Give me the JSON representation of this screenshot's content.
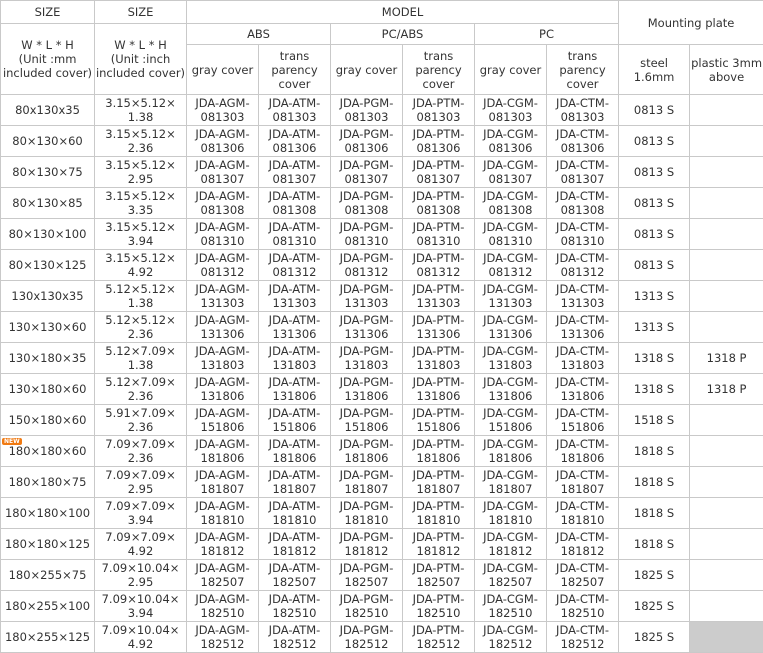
{
  "headers": {
    "size_mm_top": "SIZE",
    "size_inch_top": "SIZE",
    "model": "MODEL",
    "mounting_plate": "Mounting plate",
    "abs": "ABS",
    "pc_abs": "PC/ABS",
    "pc": "PC",
    "size_mm_sub": "W * L * H\n(Unit :mm\nincluded cover)",
    "size_inch_sub": "W * L * H\n(Unit :inch\nincluded cover)",
    "gray_cover": "gray cover",
    "trans_cover": "trans\nparency\ncover",
    "steel": "steel\n1.6mm",
    "plastic": "plastic 3mm\nabove"
  },
  "new_badge": "NEW",
  "rows": [
    {
      "mm": "80x130x35",
      "inch": "3.15×5.12×\n1.38",
      "abs_gray": "JDA-AGM-\n081303",
      "abs_trans": "JDA-ATM-\n081303",
      "pcabs_gray": "JDA-PGM-\n081303",
      "pcabs_trans": "JDA-PTM-\n081303",
      "pc_gray": "JDA-CGM-\n081303",
      "pc_trans": "JDA-CTM-\n081303",
      "steel": "0813 S",
      "plastic": ""
    },
    {
      "mm": "80×130×60",
      "inch": "3.15×5.12×\n2.36",
      "abs_gray": "JDA-AGM-\n081306",
      "abs_trans": "JDA-ATM-\n081306",
      "pcabs_gray": "JDA-PGM-\n081306",
      "pcabs_trans": "JDA-PTM-\n081306",
      "pc_gray": "JDA-CGM-\n081306",
      "pc_trans": "JDA-CTM-\n081306",
      "steel": "0813 S",
      "plastic": ""
    },
    {
      "mm": "80×130×75",
      "inch": "3.15×5.12×\n2.95",
      "abs_gray": "JDA-AGM-\n081307",
      "abs_trans": "JDA-ATM-\n081307",
      "pcabs_gray": "JDA-PGM-\n081307",
      "pcabs_trans": "JDA-PTM-\n081307",
      "pc_gray": "JDA-CGM-\n081307",
      "pc_trans": "JDA-CTM-\n081307",
      "steel": "0813 S",
      "plastic": ""
    },
    {
      "mm": "80×130×85",
      "inch": "3.15×5.12×\n3.35",
      "abs_gray": "JDA-AGM-\n081308",
      "abs_trans": "JDA-ATM-\n081308",
      "pcabs_gray": "JDA-PGM-\n081308",
      "pcabs_trans": "JDA-PTM-\n081308",
      "pc_gray": "JDA-CGM-\n081308",
      "pc_trans": "JDA-CTM-\n081308",
      "steel": "0813 S",
      "plastic": ""
    },
    {
      "mm": "80×130×100",
      "inch": "3.15×5.12×\n3.94",
      "abs_gray": "JDA-AGM-\n081310",
      "abs_trans": "JDA-ATM-\n081310",
      "pcabs_gray": "JDA-PGM-\n081310",
      "pcabs_trans": "JDA-PTM-\n081310",
      "pc_gray": "JDA-CGM-\n081310",
      "pc_trans": "JDA-CTM-\n081310",
      "steel": "0813 S",
      "plastic": ""
    },
    {
      "mm": "80×130×125",
      "inch": "3.15×5.12×\n4.92",
      "abs_gray": "JDA-AGM-\n081312",
      "abs_trans": "JDA-ATM-\n081312",
      "pcabs_gray": "JDA-PGM-\n081312",
      "pcabs_trans": "JDA-PTM-\n081312",
      "pc_gray": "JDA-CGM-\n081312",
      "pc_trans": "JDA-CTM-\n081312",
      "steel": "0813 S",
      "plastic": ""
    },
    {
      "mm": "130x130x35",
      "inch": "5.12×5.12×\n1.38",
      "abs_gray": "JDA-AGM-\n131303",
      "abs_trans": "JDA-ATM-\n131303",
      "pcabs_gray": "JDA-PGM-\n131303",
      "pcabs_trans": "JDA-PTM-\n131303",
      "pc_gray": "JDA-CGM-\n131303",
      "pc_trans": "JDA-CTM-\n131303",
      "steel": "1313 S",
      "plastic": ""
    },
    {
      "mm": "130×130×60",
      "inch": "5.12×5.12×\n2.36",
      "abs_gray": "JDA-AGM-\n131306",
      "abs_trans": "JDA-ATM-\n131306",
      "pcabs_gray": "JDA-PGM-\n131306",
      "pcabs_trans": "JDA-PTM-\n131306",
      "pc_gray": "JDA-CGM-\n131306",
      "pc_trans": "JDA-CTM-\n131306",
      "steel": "1313 S",
      "plastic": ""
    },
    {
      "mm": "130×180×35",
      "inch": "5.12×7.09×\n1.38",
      "abs_gray": "JDA-AGM-\n131803",
      "abs_trans": "JDA-ATM-\n131803",
      "pcabs_gray": "JDA-PGM-\n131803",
      "pcabs_trans": "JDA-PTM-\n131803",
      "pc_gray": "JDA-CGM-\n131803",
      "pc_trans": "JDA-CTM-\n131803",
      "steel": "1318 S",
      "plastic": "1318 P"
    },
    {
      "mm": "130×180×60",
      "inch": "5.12×7.09×\n2.36",
      "abs_gray": "JDA-AGM-\n131806",
      "abs_trans": "JDA-ATM-\n131806",
      "pcabs_gray": "JDA-PGM-\n131806",
      "pcabs_trans": "JDA-PTM-\n131806",
      "pc_gray": "JDA-CGM-\n131806",
      "pc_trans": "JDA-CTM-\n131806",
      "steel": "1318 S",
      "plastic": "1318 P"
    },
    {
      "mm": "150×180×60",
      "inch": "5.91×7.09×\n2.36",
      "abs_gray": "JDA-AGM-\n151806",
      "abs_trans": "JDA-ATM-\n151806",
      "pcabs_gray": "JDA-PGM-\n151806",
      "pcabs_trans": "JDA-PTM-\n151806",
      "pc_gray": "JDA-CGM-\n151806",
      "pc_trans": "JDA-CTM-\n151806",
      "steel": "1518 S",
      "plastic": ""
    },
    {
      "mm": "180×180×60",
      "inch": "7.09×7.09×\n2.36",
      "abs_gray": "JDA-AGM-\n181806",
      "abs_trans": "JDA-ATM-\n181806",
      "pcabs_gray": "JDA-PGM-\n181806",
      "pcabs_trans": "JDA-PTM-\n181806",
      "pc_gray": "JDA-CGM-\n181806",
      "pc_trans": "JDA-CTM-\n181806",
      "steel": "1818 S",
      "plastic": "",
      "is_new": true
    },
    {
      "mm": "180×180×75",
      "inch": "7.09×7.09×\n2.95",
      "abs_gray": "JDA-AGM-\n181807",
      "abs_trans": "JDA-ATM-\n181807",
      "pcabs_gray": "JDA-PGM-\n181807",
      "pcabs_trans": "JDA-PTM-\n181807",
      "pc_gray": "JDA-CGM-\n181807",
      "pc_trans": "JDA-CTM-\n181807",
      "steel": "1818 S",
      "plastic": ""
    },
    {
      "mm": "180×180×100",
      "inch": "7.09×7.09×\n3.94",
      "abs_gray": "JDA-AGM-\n181810",
      "abs_trans": "JDA-ATM-\n181810",
      "pcabs_gray": "JDA-PGM-\n181810",
      "pcabs_trans": "JDA-PTM-\n181810",
      "pc_gray": "JDA-CGM-\n181810",
      "pc_trans": "JDA-CTM-\n181810",
      "steel": "1818 S",
      "plastic": ""
    },
    {
      "mm": "180×180×125",
      "inch": "7.09×7.09×\n4.92",
      "abs_gray": "JDA-AGM-\n181812",
      "abs_trans": "JDA-ATM-\n181812",
      "pcabs_gray": "JDA-PGM-\n181812",
      "pcabs_trans": "JDA-PTM-\n181812",
      "pc_gray": "JDA-CGM-\n181812",
      "pc_trans": "JDA-CTM-\n181812",
      "steel": "1818 S",
      "plastic": ""
    },
    {
      "mm": "180×255×75",
      "inch": "7.09×10.04×\n2.95",
      "abs_gray": "JDA-AGM-\n182507",
      "abs_trans": "JDA-ATM-\n182507",
      "pcabs_gray": "JDA-PGM-\n182507",
      "pcabs_trans": "JDA-PTM-\n182507",
      "pc_gray": "JDA-CGM-\n182507",
      "pc_trans": "JDA-CTM-\n182507",
      "steel": "1825 S",
      "plastic": ""
    },
    {
      "mm": "180×255×100",
      "inch": "7.09×10.04×\n3.94",
      "abs_gray": "JDA-AGM-\n182510",
      "abs_trans": "JDA-ATM-\n182510",
      "pcabs_gray": "JDA-PGM-\n182510",
      "pcabs_trans": "JDA-PTM-\n182510",
      "pc_gray": "JDA-CGM-\n182510",
      "pc_trans": "JDA-CTM-\n182510",
      "steel": "1825 S",
      "plastic": ""
    },
    {
      "mm": "180×255×125",
      "inch": "7.09×10.04×\n4.92",
      "abs_gray": "JDA-AGM-\n182512",
      "abs_trans": "JDA-ATM-\n182512",
      "pcabs_gray": "JDA-PGM-\n182512",
      "pcabs_trans": "JDA-PTM-\n182512",
      "pc_gray": "JDA-CGM-\n182512",
      "pc_trans": "JDA-CTM-\n182512",
      "steel": "1825 S",
      "plastic": "",
      "plastic_shaded": true
    }
  ],
  "colors": {
    "border": "#c9c9c9",
    "text": "#333333",
    "new_badge": "#f07a12",
    "shaded_cell": "#cccccc"
  }
}
